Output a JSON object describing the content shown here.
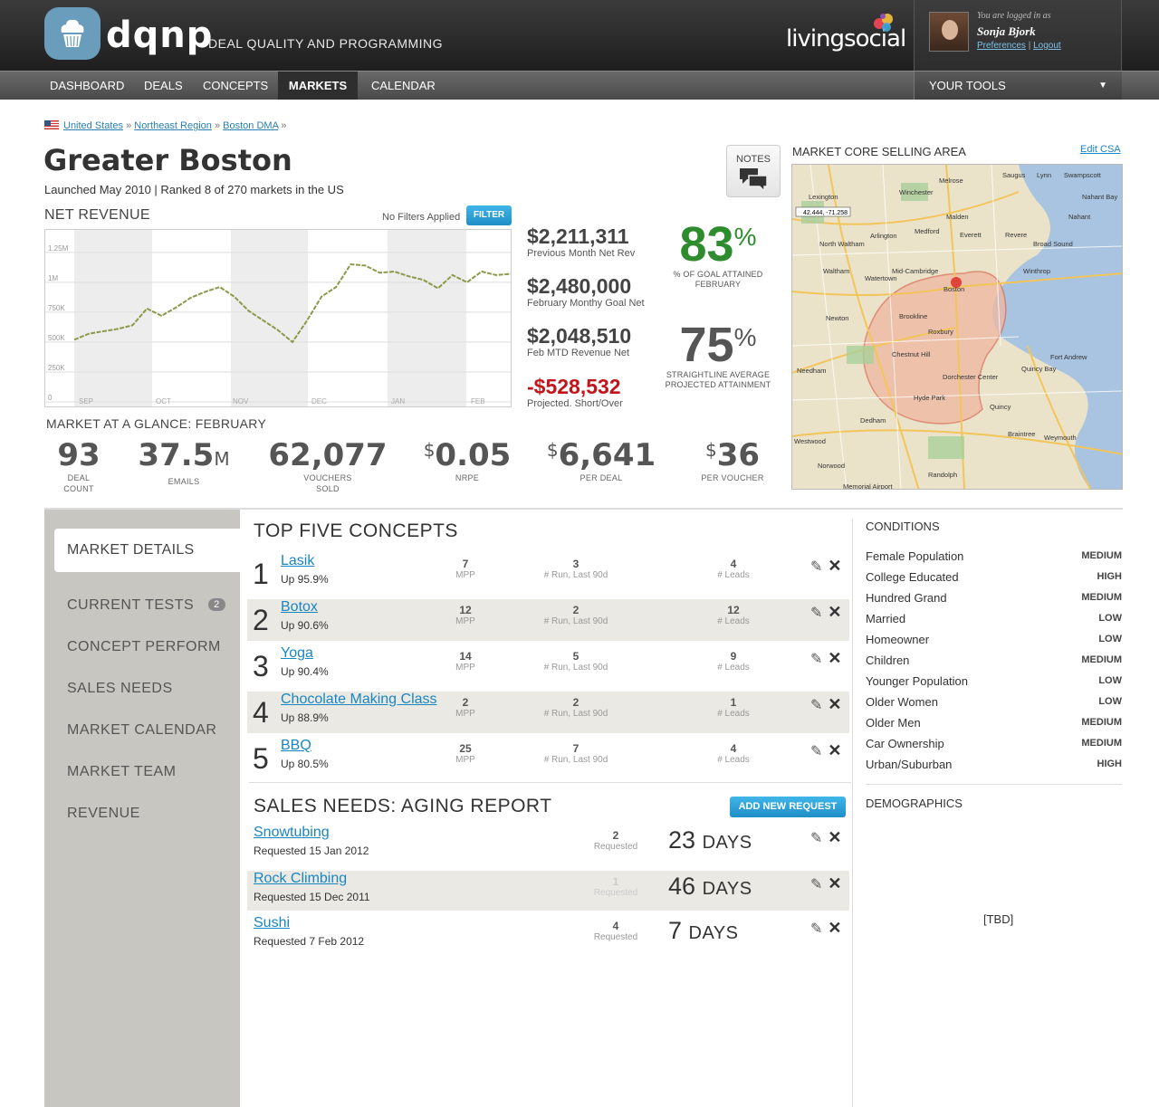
{
  "header": {
    "brand": "dqnp",
    "tagline": "DEAL QUALITY AND PROGRAMMING",
    "partner": "livingsocial",
    "user": {
      "logged_in_as": "You are logged in as",
      "name": "Sonja Bjork",
      "preferences": "Preferences",
      "sep": "|",
      "logout": "Logout"
    }
  },
  "nav": {
    "items": [
      "DASHBOARD",
      "DEALS",
      "CONCEPTS",
      "MARKETS",
      "CALENDAR"
    ],
    "active": "MARKETS",
    "tools": "YOUR TOOLS"
  },
  "breadcrumb": {
    "items": [
      "United States",
      "Northeast Region",
      "Boston DMA"
    ],
    "sep": "»"
  },
  "market": {
    "title": "Greater Boston",
    "subtitle": "Launched May 2010 | Ranked 8 of 270 markets in the US",
    "notes": "NOTES"
  },
  "net_revenue": {
    "title": "NET REVENUE",
    "filter_text": "No Filters Applied",
    "filter_btn": "FILTER"
  },
  "chart_data": {
    "type": "line",
    "title": "NET REVENUE",
    "x_ticks": [
      "SEP",
      "OCT",
      "NOV",
      "DEC",
      "JAN",
      "FEB"
    ],
    "y_ticks": [
      "0",
      "250K",
      "500K",
      "750K",
      "1M",
      "1.25M"
    ],
    "ylim": [
      0,
      1400000
    ],
    "grid": true,
    "series": [
      {
        "values": [
          520000,
          570000,
          590000,
          610000,
          640000,
          780000,
          720000,
          790000,
          870000,
          920000,
          960000,
          880000,
          760000,
          680000,
          600000,
          500000,
          680000,
          880000,
          960000,
          1150000,
          1140000,
          1080000,
          1090000,
          1050000,
          1020000,
          950000,
          1060000,
          1000000,
          1090000,
          1060000,
          1070000
        ]
      }
    ]
  },
  "stats": [
    {
      "value": "$2,211,311",
      "label": "Previous Month Net Rev"
    },
    {
      "value": "$2,480,000",
      "label": "February Monthy Goal Net"
    },
    {
      "value": "$2,048,510",
      "label": "Feb MTD Revenue Net"
    },
    {
      "value": "-$528,532",
      "label": "Projected. Short/Over"
    }
  ],
  "percents": [
    {
      "value": "83",
      "sym": "%",
      "label1": "% OF GOAL ATTAINED",
      "label2": "FEBRUARY",
      "color": "#2e8b2e"
    },
    {
      "value": "75",
      "sym": "%",
      "label1": "STRAIGHTLINE AVERAGE",
      "label2": "PROJECTED ATTAINMENT",
      "color": "#555555"
    }
  ],
  "map": {
    "title": "MARKET CORE SELLING AREA",
    "edit": "Edit CSA",
    "coords": "42.444, -71.258",
    "places": [
      "Saugus",
      "Lynn",
      "Swampscott",
      "Lexington",
      "Winchester",
      "Melrose",
      "Nahant Bay",
      "Malden",
      "Nahant",
      "Arlington",
      "Medford",
      "Everett",
      "Revere",
      "North Waltham",
      "Broad Sound",
      "Mid-Cambridge",
      "Winthrop",
      "Waltham",
      "Watertown",
      "Boston",
      "Newton",
      "Brookline",
      "Roxbury",
      "Fort Andrew",
      "Chestnut Hill",
      "Quincy Bay",
      "Needham",
      "Dorchester Center",
      "Hyde Park",
      "Quincy",
      "Dedham",
      "Braintree",
      "Weymouth",
      "Westwood",
      "Norwood",
      "Randolph",
      "Memorial Airport"
    ]
  },
  "glance": {
    "title": "MARKET AT A GLANCE: FEBRUARY",
    "items": [
      {
        "value": "93",
        "unit": "",
        "prefix": "",
        "label1": "DEAL",
        "label2": "COUNT"
      },
      {
        "value": "37.5",
        "unit": "M",
        "prefix": "",
        "label1": "EMAILS",
        "label2": ""
      },
      {
        "value": "62,077",
        "unit": "",
        "prefix": "",
        "label1": "VOUCHERS",
        "label2": "SOLD"
      },
      {
        "value": "0.05",
        "unit": "",
        "prefix": "$",
        "label1": "NRPE",
        "label2": ""
      },
      {
        "value": "6,641",
        "unit": "",
        "prefix": "$",
        "label1": "PER DEAL",
        "label2": ""
      },
      {
        "value": "36",
        "unit": "",
        "prefix": "$",
        "label1": "PER VOUCHER",
        "label2": ""
      }
    ]
  },
  "sidebar": {
    "selected": "MARKET DETAILS",
    "items": [
      {
        "label": "CURRENT TESTS",
        "badge": "2"
      },
      {
        "label": "CONCEPT PERFORM"
      },
      {
        "label": "SALES NEEDS"
      },
      {
        "label": "MARKET CALENDAR"
      },
      {
        "label": "MARKET TEAM"
      },
      {
        "label": "REVENUE"
      }
    ]
  },
  "concepts": {
    "title": "TOP FIVE CONCEPTS",
    "metric_labels": [
      "MPP",
      "# Run, Last 90d",
      "# Leads"
    ],
    "rows": [
      {
        "rank": "1",
        "name": "Lasik",
        "up": "Up 95.9%",
        "mpp": "7",
        "run": "3",
        "leads": "4"
      },
      {
        "rank": "2",
        "name": "Botox",
        "up": "Up 90.6%",
        "mpp": "12",
        "run": "2",
        "leads": "12"
      },
      {
        "rank": "3",
        "name": "Yoga",
        "up": "Up 90.4%",
        "mpp": "14",
        "run": "5",
        "leads": "9"
      },
      {
        "rank": "4",
        "name": "Chocolate Making Class",
        "up": "Up 88.9%",
        "mpp": "2",
        "run": "2",
        "leads": "1"
      },
      {
        "rank": "5",
        "name": "BBQ",
        "up": "Up 80.5%",
        "mpp": "25",
        "run": "7",
        "leads": "4"
      }
    ]
  },
  "aging": {
    "title": "SALES NEEDS: AGING REPORT",
    "add_btn": "ADD NEW REQUEST",
    "count_label": "Requested",
    "rows": [
      {
        "name": "Snowtubing",
        "requested": "Requested 15 Jan 2012",
        "count": "2",
        "days": "23",
        "unit": "DAYS"
      },
      {
        "name": "Rock Climbing",
        "requested": "Requested 15 Dec 2011",
        "count": "1",
        "days": "46",
        "unit": "DAYS"
      },
      {
        "name": "Sushi",
        "requested": "Requested 7 Feb 2012",
        "count": "4",
        "days": "7",
        "unit": "DAYS"
      }
    ]
  },
  "conditions": {
    "title": "CONDITIONS",
    "rows": [
      {
        "label": "Female Population",
        "level": "MEDIUM"
      },
      {
        "label": "College Educated",
        "level": "HIGH"
      },
      {
        "label": "Hundred Grand",
        "level": "MEDIUM"
      },
      {
        "label": "Married",
        "level": "LOW"
      },
      {
        "label": "Homeowner",
        "level": "LOW"
      },
      {
        "label": "Children",
        "level": "MEDIUM"
      },
      {
        "label": "Younger Population",
        "level": "LOW"
      },
      {
        "label": "Older Women",
        "level": "LOW"
      },
      {
        "label": "Older Men",
        "level": "MEDIUM"
      },
      {
        "label": "Car Ownership",
        "level": "MEDIUM"
      },
      {
        "label": "Urban/Suburban",
        "level": "HIGH"
      }
    ]
  },
  "demographics": {
    "title": "DEMOGRAPHICS",
    "placeholder": "[TBD]"
  }
}
